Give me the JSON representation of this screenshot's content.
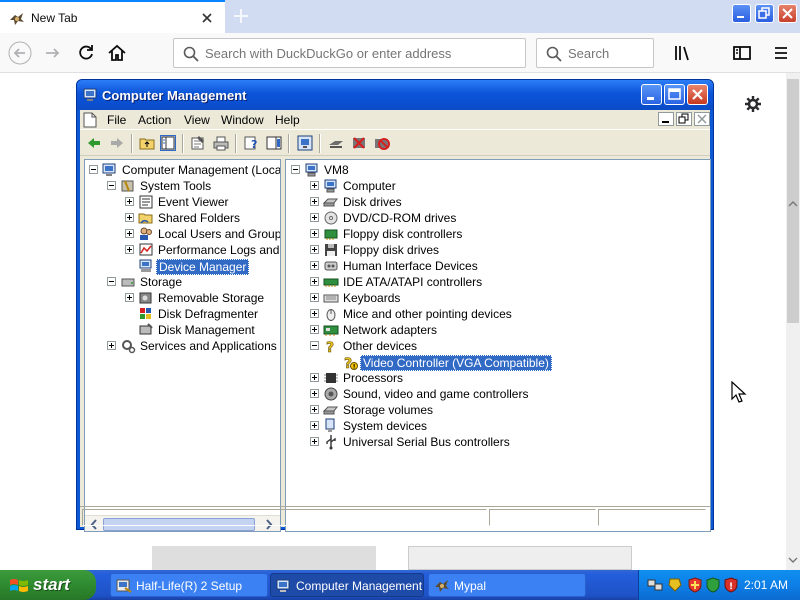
{
  "browser": {
    "tab_title": "New Tab",
    "url_placeholder": "Search with DuckDuckGo or enter address",
    "search_placeholder": "Search"
  },
  "window": {
    "title": "Computer Management",
    "menu": [
      "File",
      "Action",
      "View",
      "Window",
      "Help"
    ]
  },
  "left_tree": [
    {
      "label": "Computer Management (Local)",
      "level": 0,
      "expander": "minus",
      "icon": "computer-management-icon"
    },
    {
      "label": "System Tools",
      "level": 1,
      "expander": "minus",
      "icon": "system-tools-icon"
    },
    {
      "label": "Event Viewer",
      "level": 2,
      "expander": "plus",
      "icon": "event-viewer-icon"
    },
    {
      "label": "Shared Folders",
      "level": 2,
      "expander": "plus",
      "icon": "shared-folders-icon"
    },
    {
      "label": "Local Users and Groups",
      "level": 2,
      "expander": "plus",
      "icon": "users-icon"
    },
    {
      "label": "Performance Logs and Alerts",
      "level": 2,
      "expander": "plus",
      "icon": "performance-icon"
    },
    {
      "label": "Device Manager",
      "level": 2,
      "expander": "none",
      "icon": "device-manager-icon",
      "selected": true
    },
    {
      "label": "Storage",
      "level": 1,
      "expander": "minus",
      "icon": "storage-icon"
    },
    {
      "label": "Removable Storage",
      "level": 2,
      "expander": "plus",
      "icon": "removable-storage-icon"
    },
    {
      "label": "Disk Defragmenter",
      "level": 2,
      "expander": "none",
      "icon": "defragmenter-icon"
    },
    {
      "label": "Disk Management",
      "level": 2,
      "expander": "none",
      "icon": "disk-management-icon"
    },
    {
      "label": "Services and Applications",
      "level": 1,
      "expander": "plus",
      "icon": "services-icon"
    }
  ],
  "right_tree": [
    {
      "label": "VM8",
      "level": 0,
      "expander": "minus",
      "icon": "computer-icon"
    },
    {
      "label": "Computer",
      "level": 1,
      "expander": "plus",
      "icon": "computer-icon"
    },
    {
      "label": "Disk drives",
      "level": 1,
      "expander": "plus",
      "icon": "disk-drive-icon"
    },
    {
      "label": "DVD/CD-ROM drives",
      "level": 1,
      "expander": "plus",
      "icon": "cdrom-icon"
    },
    {
      "label": "Floppy disk controllers",
      "level": 1,
      "expander": "plus",
      "icon": "floppy-controller-icon"
    },
    {
      "label": "Floppy disk drives",
      "level": 1,
      "expander": "plus",
      "icon": "floppy-drive-icon"
    },
    {
      "label": "Human Interface Devices",
      "level": 1,
      "expander": "plus",
      "icon": "hid-icon"
    },
    {
      "label": "IDE ATA/ATAPI controllers",
      "level": 1,
      "expander": "plus",
      "icon": "ide-icon"
    },
    {
      "label": "Keyboards",
      "level": 1,
      "expander": "plus",
      "icon": "keyboard-icon"
    },
    {
      "label": "Mice and other pointing devices",
      "level": 1,
      "expander": "plus",
      "icon": "mouse-icon"
    },
    {
      "label": "Network adapters",
      "level": 1,
      "expander": "plus",
      "icon": "network-icon"
    },
    {
      "label": "Other devices",
      "level": 1,
      "expander": "minus",
      "icon": "unknown-device-icon"
    },
    {
      "label": "Video Controller (VGA Compatible)",
      "level": 2,
      "expander": "none",
      "icon": "warning-device-icon",
      "selected": true
    },
    {
      "label": "Processors",
      "level": 1,
      "expander": "plus",
      "icon": "processor-icon"
    },
    {
      "label": "Sound, video and game controllers",
      "level": 1,
      "expander": "plus",
      "icon": "sound-icon"
    },
    {
      "label": "Storage volumes",
      "level": 1,
      "expander": "plus",
      "icon": "storage-volume-icon"
    },
    {
      "label": "System devices",
      "level": 1,
      "expander": "plus",
      "icon": "system-device-icon"
    },
    {
      "label": "Universal Serial Bus controllers",
      "level": 1,
      "expander": "plus",
      "icon": "usb-icon"
    }
  ],
  "taskbar": {
    "start": "start",
    "tasks": [
      {
        "label": "Half-Life(R) 2 Setup",
        "active": false
      },
      {
        "label": "Computer Management",
        "active": true
      },
      {
        "label": "Mypal",
        "active": false
      }
    ],
    "clock": "2:01 AM"
  }
}
